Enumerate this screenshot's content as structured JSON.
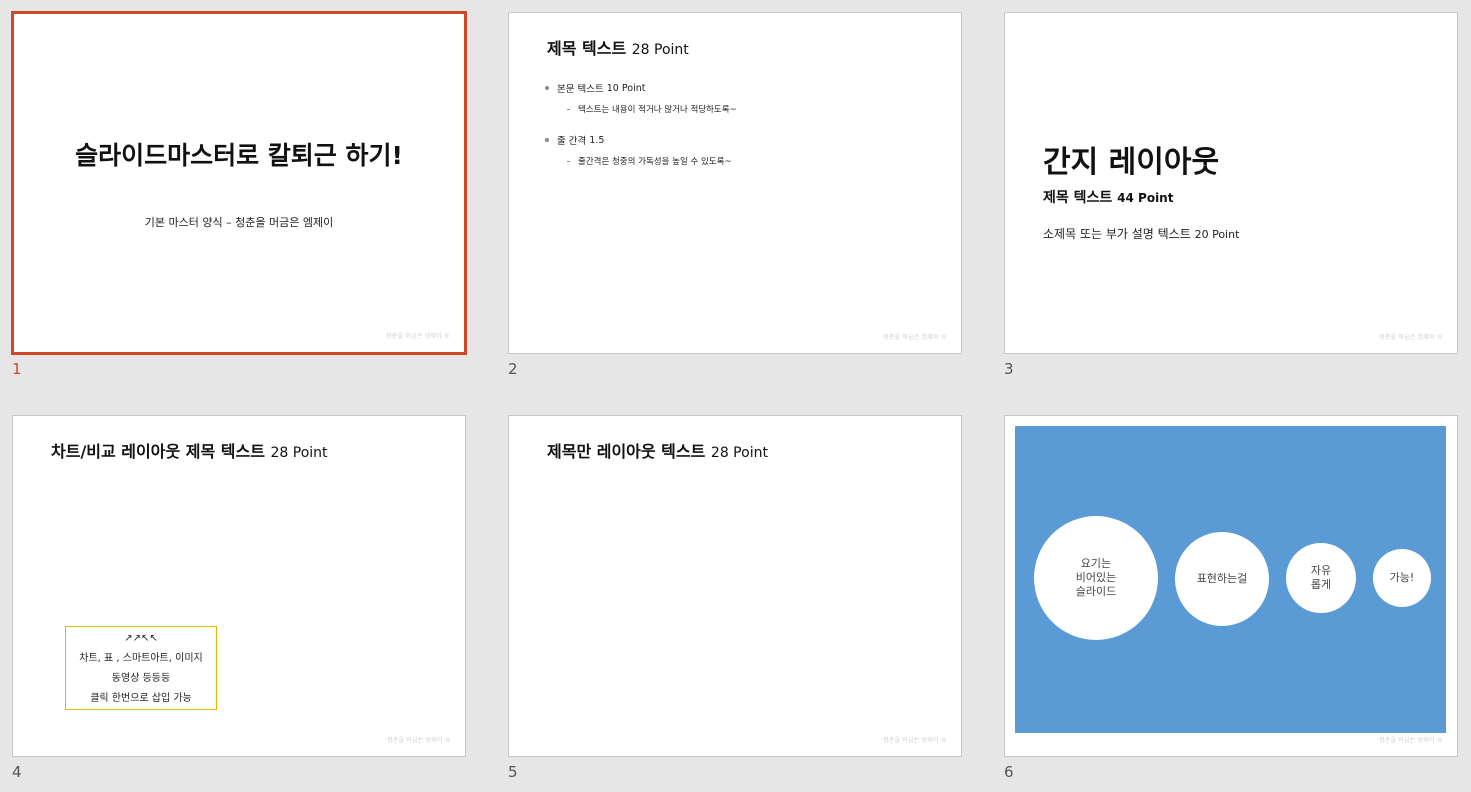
{
  "footer_mark": "청춘을 머금은 엠제이 ®",
  "slides": [
    {
      "number": "1",
      "title": "슬라이드마스터로 칼퇴근 하기!",
      "subtitle": "기본 마스터 양식 – 청춘을 머금은 엠제이"
    },
    {
      "number": "2",
      "title": "제목 텍스트",
      "title_pt": "28 Point",
      "bullets": [
        {
          "label": "본문 텍스트",
          "pt": "10 Point",
          "sub": "텍스트는 내용이 적거나 많거나 적당하도록~"
        },
        {
          "label": "줄 간격",
          "pt": "1.5",
          "sub": "줄간격은 청중의 가독성을 높일 수  있도록~"
        }
      ]
    },
    {
      "number": "3",
      "title": "간지 레이아웃",
      "subtitle": "제목 텍스트",
      "subtitle_pt": "44 Point",
      "desc": "소제목 또는 부가 설명 텍스트",
      "desc_pt": "20 Point"
    },
    {
      "number": "4",
      "title": "차트/비교 레이아웃 제목 텍스트",
      "title_pt": "28 Point",
      "box_lines": [
        "↗↗↖↖",
        "차트, 표 , 스마트아트, 이미지",
        "동영상 등등등",
        "클릭 한번으로 삽입 가능"
      ]
    },
    {
      "number": "5",
      "title": "제목만 레이아웃 텍스트",
      "title_pt": "28 Point"
    },
    {
      "number": "6",
      "circles": [
        {
          "text_lines": [
            "요기는",
            "비어있는",
            "슬라이드"
          ]
        },
        {
          "text_lines": [
            "표현하는걸"
          ]
        },
        {
          "text_lines": [
            "자유",
            "롭게"
          ]
        },
        {
          "text_lines": [
            "가능!"
          ]
        }
      ],
      "panel_color": "#5b9bd5"
    }
  ],
  "selected_slide": "1",
  "accent_color": "#d24726"
}
